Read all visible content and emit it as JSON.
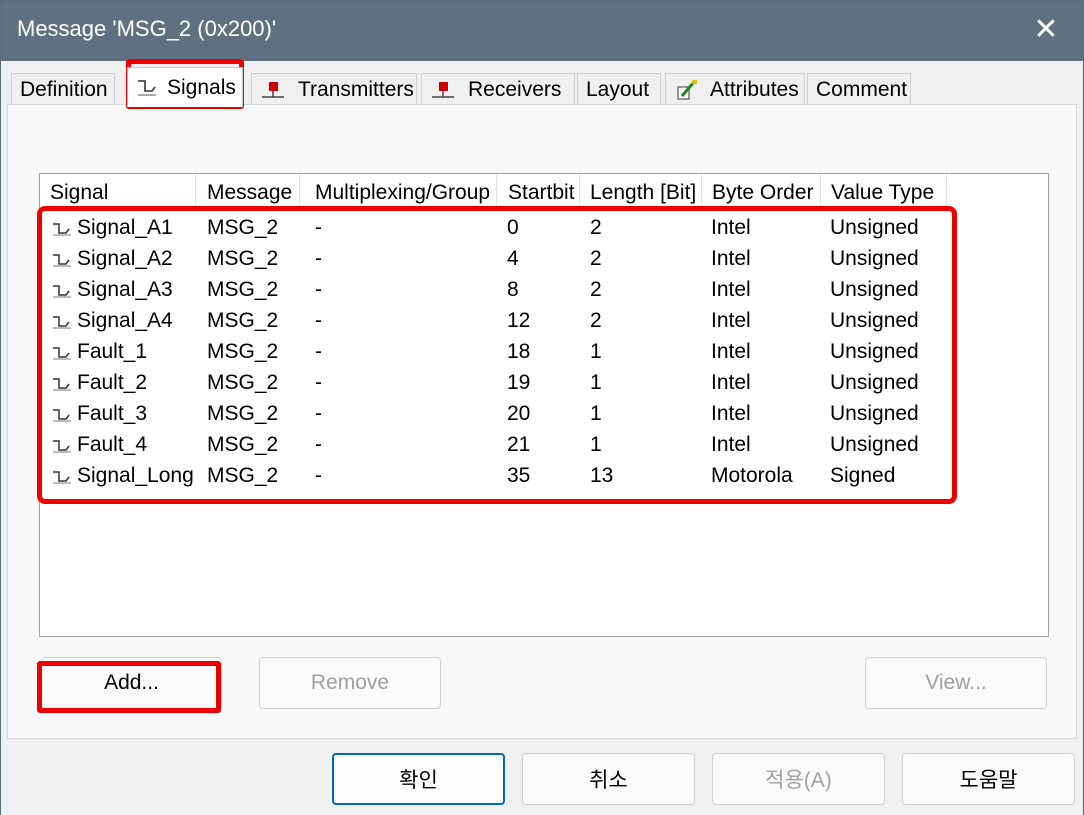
{
  "window": {
    "title": "Message 'MSG_2 (0x200)'",
    "close_glyph": "✕"
  },
  "tabs": [
    {
      "label": "Definition",
      "icon": null
    },
    {
      "label": "Signals",
      "icon": "signal-icon"
    },
    {
      "label": "Transmitters",
      "icon": "node-icon"
    },
    {
      "label": "Receivers",
      "icon": "node-icon"
    },
    {
      "label": "Layout",
      "icon": null
    },
    {
      "label": "Attributes",
      "icon": "attribute-icon"
    },
    {
      "label": "Comment",
      "icon": null
    }
  ],
  "active_tab": "Signals",
  "table": {
    "columns": [
      "Signal",
      "Message",
      "Multiplexing/Group",
      "Startbit",
      "Length [Bit]",
      "Byte Order",
      "Value Type"
    ],
    "rows": [
      [
        "Signal_A1",
        "MSG_2",
        "-",
        "0",
        "2",
        "Intel",
        "Unsigned"
      ],
      [
        "Signal_A2",
        "MSG_2",
        "-",
        "4",
        "2",
        "Intel",
        "Unsigned"
      ],
      [
        "Signal_A3",
        "MSG_2",
        "-",
        "8",
        "2",
        "Intel",
        "Unsigned"
      ],
      [
        "Signal_A4",
        "MSG_2",
        "-",
        "12",
        "2",
        "Intel",
        "Unsigned"
      ],
      [
        "Fault_1",
        "MSG_2",
        "-",
        "18",
        "1",
        "Intel",
        "Unsigned"
      ],
      [
        "Fault_2",
        "MSG_2",
        "-",
        "19",
        "1",
        "Intel",
        "Unsigned"
      ],
      [
        "Fault_3",
        "MSG_2",
        "-",
        "20",
        "1",
        "Intel",
        "Unsigned"
      ],
      [
        "Fault_4",
        "MSG_2",
        "-",
        "21",
        "1",
        "Intel",
        "Unsigned"
      ],
      [
        "Signal_Long",
        "MSG_2",
        "-",
        "35",
        "13",
        "Motorola",
        "Signed"
      ]
    ]
  },
  "buttons": {
    "add": "Add...",
    "remove": "Remove",
    "view": "View..."
  },
  "footer": {
    "ok": "확인",
    "cancel": "취소",
    "apply": "적용(A)",
    "help": "도움말"
  },
  "colors": {
    "titlebar": "#5f7180",
    "highlight": "#ee0000",
    "primary_border": "#0067c0",
    "node_icon": "#cc0000"
  }
}
